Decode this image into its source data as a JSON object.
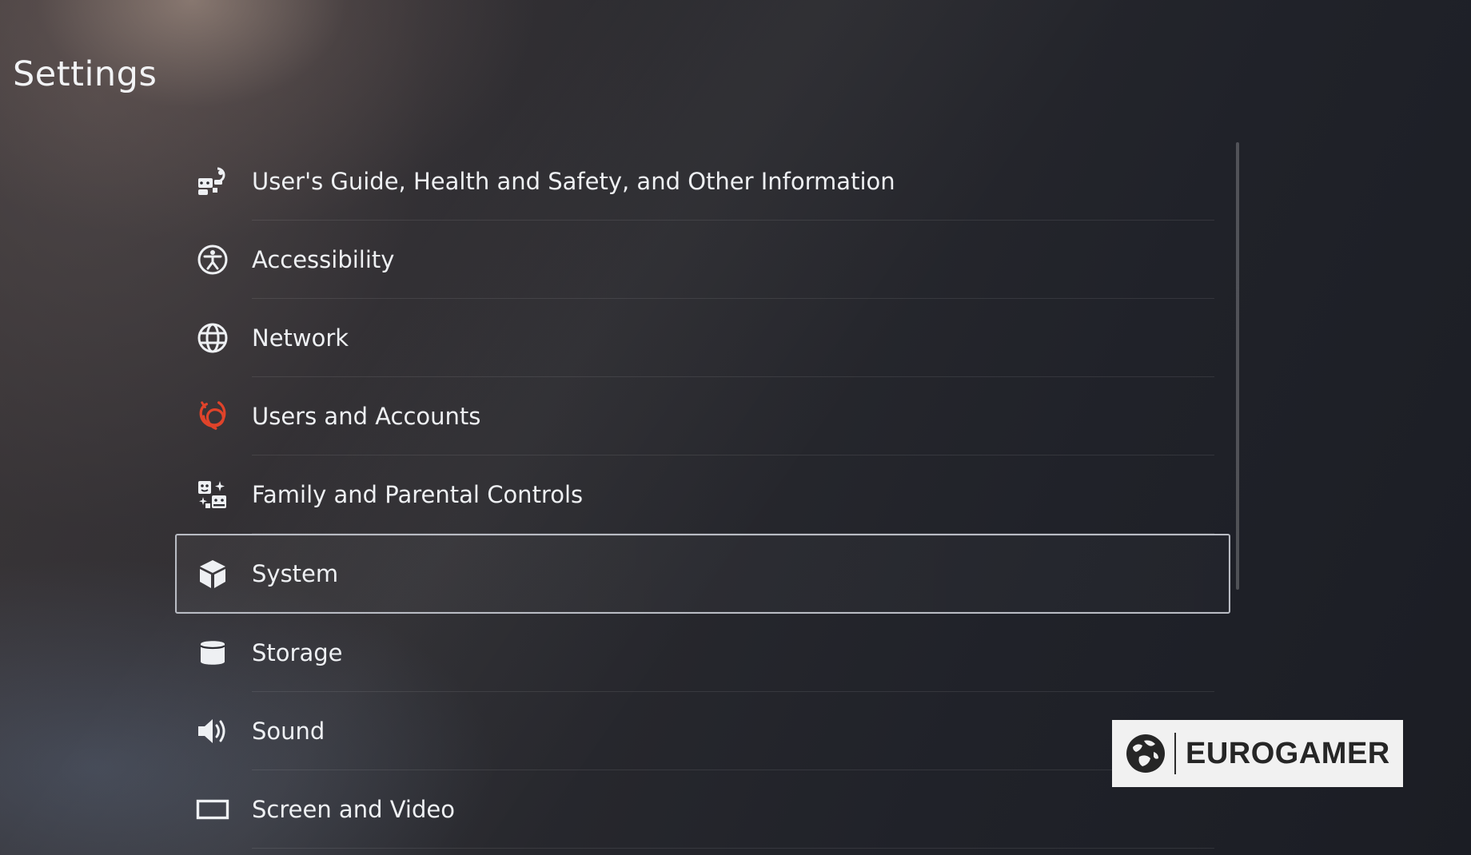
{
  "page": {
    "title": "Settings"
  },
  "menu": {
    "items": [
      {
        "label": "User's Guide, Health and Safety, and Other Information",
        "icon": "info-guide-icon"
      },
      {
        "label": "Accessibility",
        "icon": "accessibility-icon"
      },
      {
        "label": "Network",
        "icon": "globe-icon"
      },
      {
        "label": "Users and Accounts",
        "icon": "users-accounts-icon"
      },
      {
        "label": "Family and Parental Controls",
        "icon": "family-icon"
      },
      {
        "label": "System",
        "icon": "cube-icon",
        "selected": true
      },
      {
        "label": "Storage",
        "icon": "storage-icon"
      },
      {
        "label": "Sound",
        "icon": "speaker-icon"
      },
      {
        "label": "Screen and Video",
        "icon": "screen-icon"
      }
    ]
  },
  "watermark": {
    "text": "EUROGAMER",
    "icon": "globe-logo-icon"
  },
  "colors": {
    "accent_red": "#e0432a",
    "text": "#eef0f3",
    "selection_border": "#b9bcc4"
  }
}
